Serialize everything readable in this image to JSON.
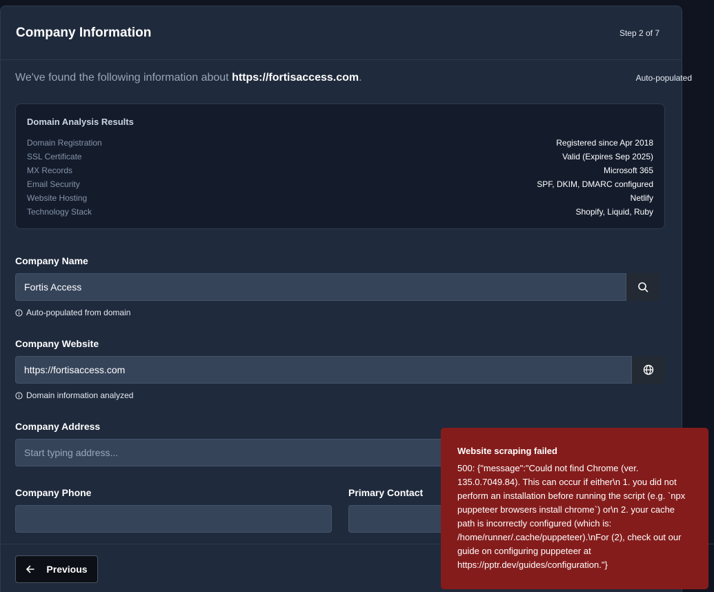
{
  "header": {
    "title": "Company Information",
    "step": "Step 2 of 7"
  },
  "intro": {
    "text": "We've found the following information about ",
    "domain": "https://fortisaccess.com",
    "suffix": ".",
    "badge": "Auto-populated"
  },
  "analysis": {
    "title": "Domain Analysis Results",
    "rows": [
      {
        "label": "Domain Registration",
        "value": "Registered since Apr 2018"
      },
      {
        "label": "SSL Certificate",
        "value": "Valid (Expires Sep 2025)"
      },
      {
        "label": "MX Records",
        "value": "Microsoft 365"
      },
      {
        "label": "Email Security",
        "value": "SPF, DKIM, DMARC configured"
      },
      {
        "label": "Website Hosting",
        "value": "Netlify"
      },
      {
        "label": "Technology Stack",
        "value": "Shopify, Liquid, Ruby"
      }
    ]
  },
  "form": {
    "company_name": {
      "label": "Company Name",
      "value": "Fortis Access",
      "hint": "Auto-populated from domain",
      "button_icon": "search-icon"
    },
    "company_website": {
      "label": "Company Website",
      "value": "https://fortisaccess.com",
      "hint": "Domain information analyzed",
      "button_icon": "globe-icon"
    },
    "company_address": {
      "label": "Company Address",
      "placeholder": "Start typing address..."
    },
    "company_phone": {
      "label": "Company Phone",
      "value": ""
    },
    "primary_contact": {
      "label": "Primary Contact",
      "value": ""
    }
  },
  "footer": {
    "previous_label": "Previous"
  },
  "toast": {
    "title": "Website scraping failed",
    "message": "500: {\"message\":\"Could not find Chrome (ver. 135.0.7049.84). This can occur if either\\n 1. you did not perform an installation before running the script (e.g. `npx puppeteer browsers install chrome`) or\\n 2. your cache path is incorrectly configured (which is: /home/runner/.cache/puppeteer).\\nFor (2), check out our guide on configuring puppeteer at https://pptr.dev/guides/configuration.\"}",
    "color": "#851c1c"
  }
}
